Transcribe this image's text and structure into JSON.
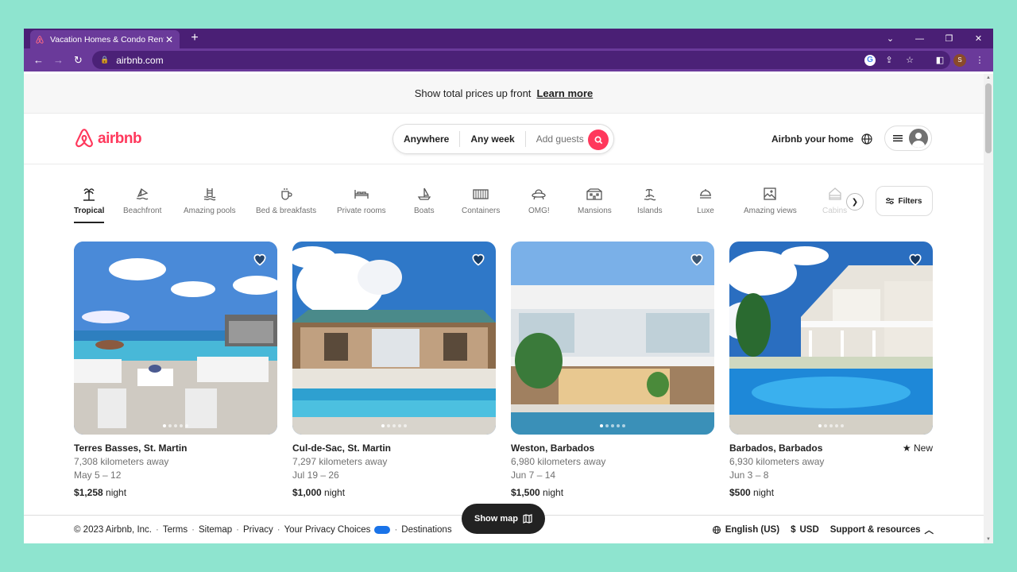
{
  "browser": {
    "tab_title": "Vacation Homes & Condo Rentals",
    "url": "airbnb.com",
    "accent_color": "#4a1f75"
  },
  "banner": {
    "text": "Show total prices up front",
    "link": "Learn more"
  },
  "header": {
    "brand": "airbnb",
    "brand_color": "#ff385c",
    "search": {
      "where": "Anywhere",
      "when": "Any week",
      "who": "Add guests"
    },
    "host_link": "Airbnb your home"
  },
  "categories": [
    {
      "label": "Tropical",
      "icon": "palm-tree-icon",
      "active": true
    },
    {
      "label": "Beachfront",
      "icon": "beachfront-icon"
    },
    {
      "label": "Amazing pools",
      "icon": "pool-icon"
    },
    {
      "label": "Bed & breakfasts",
      "icon": "coffee-icon"
    },
    {
      "label": "Private rooms",
      "icon": "bed-icon"
    },
    {
      "label": "Boats",
      "icon": "boat-icon"
    },
    {
      "label": "Containers",
      "icon": "container-icon"
    },
    {
      "label": "OMG!",
      "icon": "ufo-icon"
    },
    {
      "label": "Mansions",
      "icon": "mansion-icon"
    },
    {
      "label": "Islands",
      "icon": "island-icon"
    },
    {
      "label": "Luxe",
      "icon": "luxe-icon"
    },
    {
      "label": "Amazing views",
      "icon": "views-icon"
    },
    {
      "label": "Cabins",
      "icon": "cabin-icon"
    }
  ],
  "filters_label": "Filters",
  "listings": [
    {
      "location": "Terres Basses, St. Martin",
      "distance": "7,308 kilometers away",
      "dates": "May 5 – 12",
      "price": "$1,258",
      "unit": "night",
      "rating": ""
    },
    {
      "location": "Cul-de-Sac, St. Martin",
      "distance": "7,297 kilometers away",
      "dates": "Jul 19 – 26",
      "price": "$1,000",
      "unit": "night",
      "rating": ""
    },
    {
      "location": "Weston, Barbados",
      "distance": "6,980 kilometers away",
      "dates": "Jun 7 – 14",
      "price": "$1,500",
      "unit": "night",
      "rating": ""
    },
    {
      "location": "Barbados, Barbados",
      "distance": "6,930 kilometers away",
      "dates": "Jun 3 – 8",
      "price": "$500",
      "unit": "night",
      "rating": "New"
    }
  ],
  "show_map": "Show map",
  "footer": {
    "copyright": "© 2023 Airbnb, Inc.",
    "links": [
      "Terms",
      "Sitemap",
      "Privacy",
      "Your Privacy Choices",
      "Destinations"
    ],
    "language": "English (US)",
    "currency": "USD",
    "currency_symbol": "$",
    "support": "Support & resources"
  }
}
